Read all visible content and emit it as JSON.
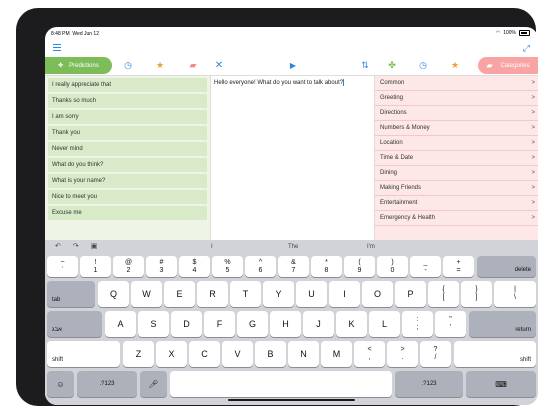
{
  "status": {
    "time": "8:48 PM",
    "date": "Wed Jun 12",
    "battery": "100%"
  },
  "toolbar": {
    "predictions_label": "Predictions",
    "categories_label": "Categories"
  },
  "phrases": [
    "I really appreciate that",
    "Thanks so much",
    "I am sorry",
    "Thank you",
    "Never mind",
    "What do you think?",
    "What is your name?",
    "Nice to meet you",
    "Excuse me"
  ],
  "editor": {
    "text": "Hello everyone! What do you want to talk about?"
  },
  "categories": [
    "Common",
    "Greeting",
    "Directions",
    "Numbers & Money",
    "Location",
    "Time & Date",
    "Dining",
    "Making Friends",
    "Entertainment",
    "Emergency & Health"
  ],
  "keyboard": {
    "suggestions": [
      "I",
      "The",
      "I'm"
    ],
    "row1": [
      {
        "top": "~",
        "bottom": "`"
      },
      {
        "top": "!",
        "bottom": "1"
      },
      {
        "top": "@",
        "bottom": "2"
      },
      {
        "top": "#",
        "bottom": "3"
      },
      {
        "top": "$",
        "bottom": "4"
      },
      {
        "top": "%",
        "bottom": "5"
      },
      {
        "top": "^",
        "bottom": "6"
      },
      {
        "top": "&",
        "bottom": "7"
      },
      {
        "top": "*",
        "bottom": "8"
      },
      {
        "top": "(",
        "bottom": "9"
      },
      {
        "top": ")",
        "bottom": "0"
      },
      {
        "top": "_",
        "bottom": "-"
      },
      {
        "top": "+",
        "bottom": "="
      }
    ],
    "delete": "delete",
    "tab": "tab",
    "row2": [
      "Q",
      "W",
      "E",
      "R",
      "T",
      "Y",
      "U",
      "I",
      "O",
      "P"
    ],
    "row2_extra": [
      {
        "top": "{",
        "bottom": "["
      },
      {
        "top": "}",
        "bottom": "]"
      },
      {
        "top": "|",
        "bottom": "\\"
      }
    ],
    "caps": "אבג",
    "row3": [
      "A",
      "S",
      "D",
      "F",
      "G",
      "H",
      "J",
      "K",
      "L"
    ],
    "row3_extra": [
      {
        "top": ":",
        "bottom": ";"
      },
      {
        "top": "\"",
        "bottom": "'"
      }
    ],
    "return": "return",
    "shift": "shift",
    "row4": [
      "Z",
      "X",
      "C",
      "V",
      "B",
      "N",
      "M"
    ],
    "row4_extra": [
      {
        "top": "<",
        "bottom": ","
      },
      {
        "top": ">",
        "bottom": "."
      },
      {
        "top": "?",
        "bottom": "/"
      }
    ],
    "numbers": ".?123"
  }
}
